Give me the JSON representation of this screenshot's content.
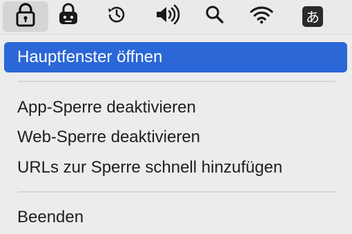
{
  "menubar": {
    "icons": [
      {
        "name": "app-lock-icon",
        "active": true
      },
      {
        "name": "robot-lock-icon"
      },
      {
        "name": "time-machine-icon"
      },
      {
        "name": "volume-icon"
      },
      {
        "name": "spotlight-search-icon"
      },
      {
        "name": "wifi-icon"
      },
      {
        "name": "input-source-icon",
        "glyph": "あ"
      }
    ]
  },
  "menu": {
    "items": [
      {
        "label": "Hauptfenster öffnen",
        "selected": true
      },
      {
        "label": "App-Sperre deaktivieren"
      },
      {
        "label": "Web-Sperre deaktivieren"
      },
      {
        "label": "URLs zur Sperre schnell hinzufügen"
      },
      {
        "label": "Beenden"
      }
    ]
  },
  "colors": {
    "selection": "#2b67d6",
    "menu_background": "#ececec",
    "text": "#1e1e1e"
  }
}
